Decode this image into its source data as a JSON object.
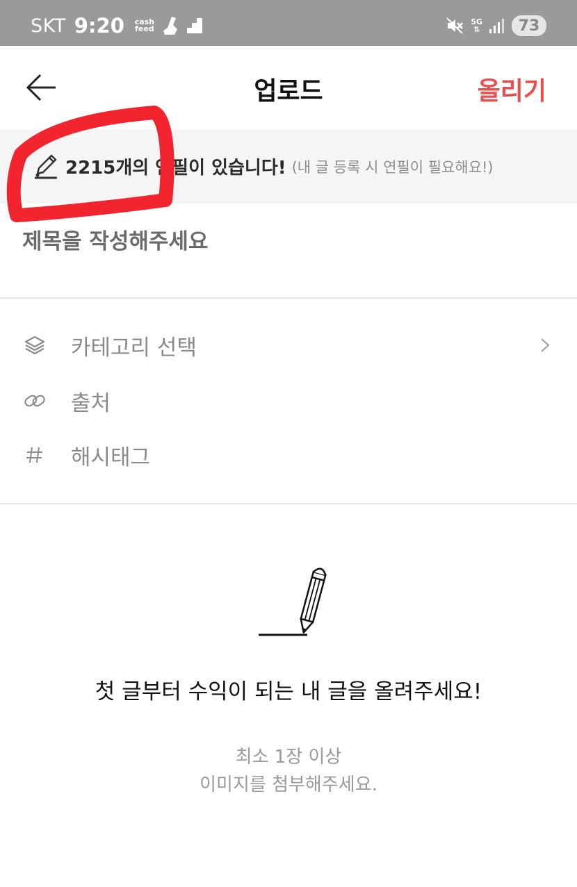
{
  "status_bar": {
    "carrier": "SKT",
    "time": "9:20",
    "cashfeed_top": "cash",
    "cashfeed_bottom": "feed",
    "network": "5G",
    "battery": "73"
  },
  "header": {
    "title": "업로드",
    "upload_label": "올리기",
    "accent_color": "#e9504d"
  },
  "notice": {
    "main": "2215개의 연필이 있습니다!",
    "sub": "(내 글 등록 시 연필이 필요해요!)"
  },
  "title_field": {
    "placeholder": "제목을 작성해주세요",
    "value": ""
  },
  "options": [
    {
      "label": "카테고리 선택",
      "icon": "layers-icon"
    },
    {
      "label": "출처",
      "icon": "link-icon"
    },
    {
      "label": "해시태그",
      "icon": "hash-icon"
    }
  ],
  "empty_state": {
    "title": "첫 글부터 수익이 되는 내 글을 올려주세요!",
    "line1": "최소 1장 이상",
    "line2": "이미지를 첨부해주세요."
  }
}
